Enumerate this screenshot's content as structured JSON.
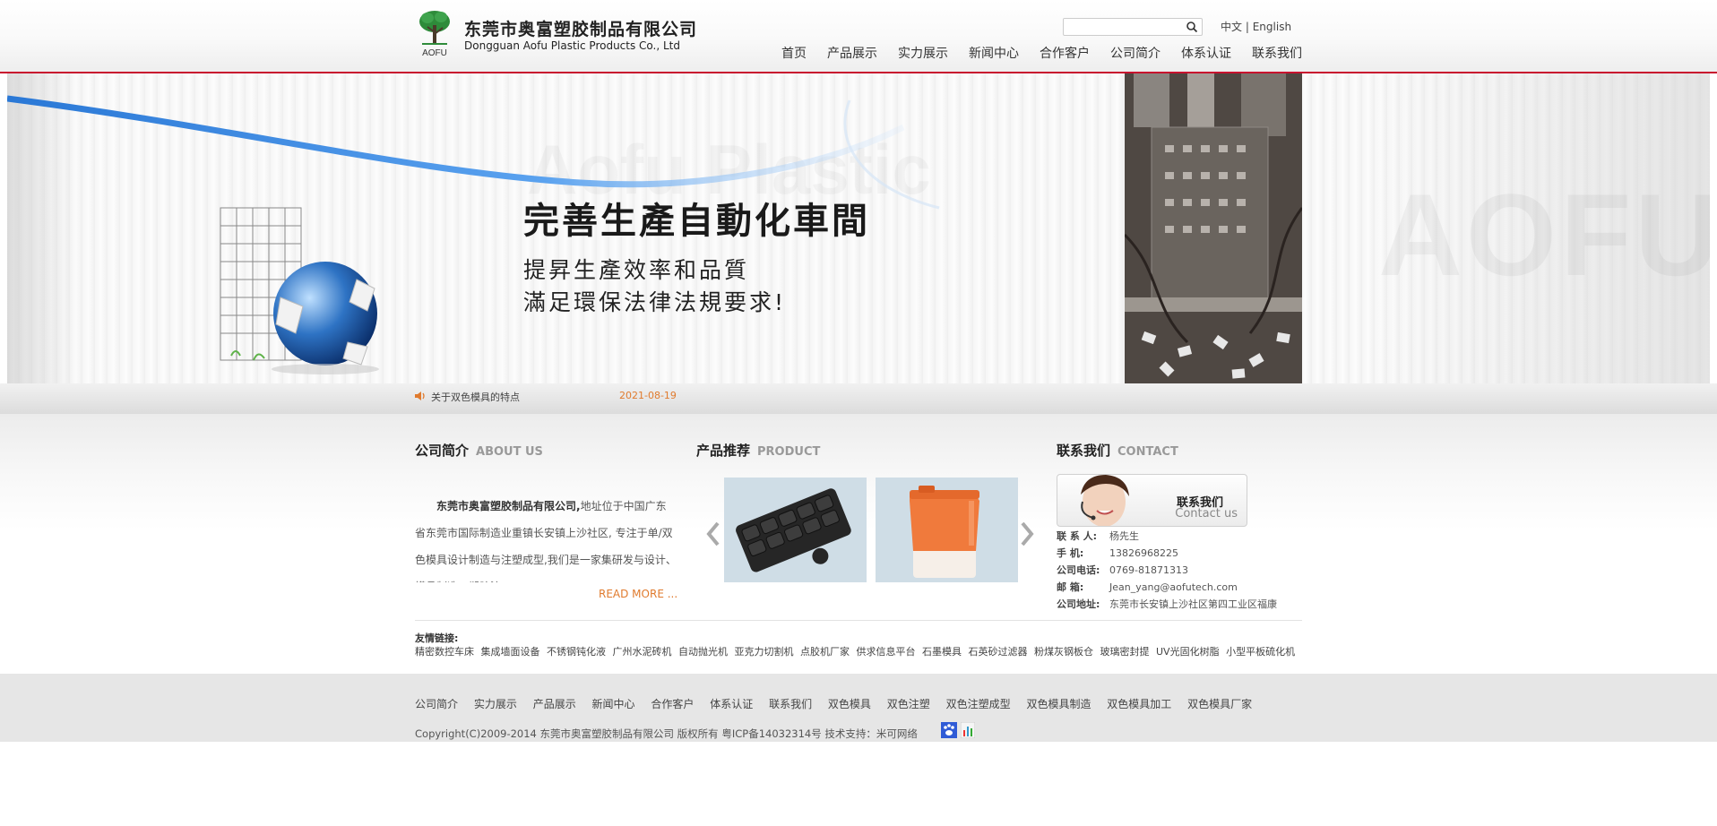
{
  "header": {
    "company_cn": "东莞市奥富塑胶制品有限公司",
    "company_en": "Dongguan Aofu Plastic Products Co., Ltd",
    "logo_text": "AOFU",
    "search": {
      "placeholder": "",
      "value": ""
    },
    "lang_cn": "中文",
    "lang_sep": "|",
    "lang_en": "English",
    "nav": [
      "首页",
      "产品展示",
      "实力展示",
      "新闻中心",
      "合作客户",
      "公司简介",
      "体系认证",
      "联系我们"
    ]
  },
  "banner": {
    "watermark_en": "Aofu Plastic",
    "watermark_brand": "AOFU",
    "headline": "完善生產自動化車間",
    "sub_line_1": "提昇生產效率和品質",
    "sub_line_2": "滿足環保法律法規要求!"
  },
  "news": {
    "title": "关于双色模具的特点",
    "date": "2021-08-19"
  },
  "about": {
    "title_cn": "公司简介",
    "title_en": "ABOUT US",
    "company_bold": "东莞市奥富塑胶制品有限公司,",
    "text": "地址位于中国广东省东莞市国际制造业重镇长安镇上沙社区, 专注于单/双色模具设计制造与注塑成型,我们是一家集研发与设计、模具制造、塑胶注",
    "more": "READ MORE ..."
  },
  "product": {
    "title_cn": "产品推荐",
    "title_en": "PRODUCT"
  },
  "contact": {
    "title_cn": "联系我们",
    "title_en": "CONTACT",
    "button_cn": "联系我们",
    "button_en": "Contact us",
    "rows": [
      {
        "label": "联 系 人:",
        "value": "杨先生"
      },
      {
        "label": "手    机:",
        "value": "13826968225"
      },
      {
        "label": "公司电话:",
        "value": "0769-81871313"
      },
      {
        "label": "邮    箱:",
        "value": "Jean_yang@aofutech.com"
      },
      {
        "label": "公司地址:",
        "value": "东莞市长安镇上沙社区第四工业区福康"
      }
    ]
  },
  "friend_links": {
    "label": "友情链接:",
    "items": [
      "精密数控车床",
      "集成墙面设备",
      "不锈钢钝化液",
      "广州水泥砖机",
      "自动抛光机",
      "亚克力切割机",
      "点胶机厂家",
      "供求信息平台",
      "石墨模具",
      "石英砂过滤器",
      "粉煤灰钢板仓",
      "玻璃密封提",
      "UV光固化树脂",
      "小型平板硫化机"
    ]
  },
  "footer": {
    "nav": [
      "公司简介",
      "实力展示",
      "产品展示",
      "新闻中心",
      "合作客户",
      "体系认证",
      "联系我们",
      "双色模具",
      "双色注塑",
      "双色注塑成型",
      "双色模具制造",
      "双色模具加工",
      "双色模具厂家"
    ],
    "copyright": "Copyright(C)2009-2014 东莞市奥富塑胶制品有限公司 版权所有 粤ICP备14032314号   技术支持：米可网络"
  },
  "colors": {
    "accent_red": "#c8102e",
    "accent_orange": "#e07b2e",
    "logo_green": "#2e8b3a"
  }
}
